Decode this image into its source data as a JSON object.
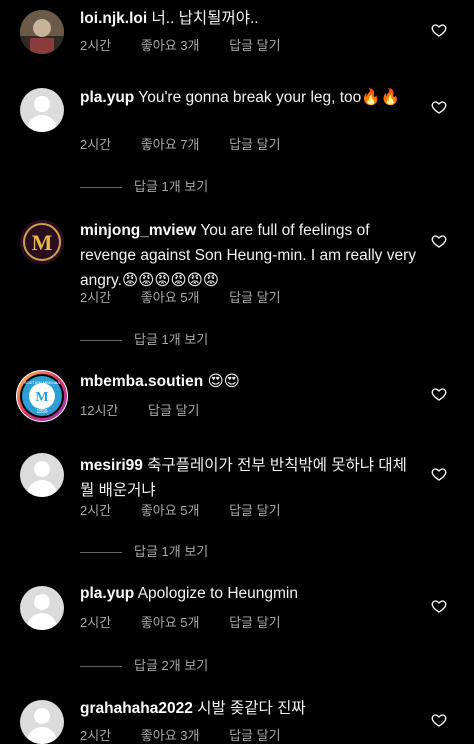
{
  "comments": [
    {
      "username": "loi.njk.loi",
      "text": "너.. 납치될꺼야..",
      "time": "2시간",
      "likes": "좋아요 3개",
      "reply": "답글 달기"
    },
    {
      "username": "pla.yup",
      "text": "You're gonna break your leg, too🔥🔥",
      "time": "2시간",
      "likes": "좋아요 7개",
      "reply": "답글 달기",
      "view_replies": "답글 1개 보기"
    },
    {
      "username": "minjong_mview",
      "text": "You are full of feelings of revenge against Son Heung-min.  I am really very angry.😡😡😡😡😡😡",
      "time": "2시간",
      "likes": "좋아요 5개",
      "reply": "답글 달기",
      "view_replies": "답글 1개 보기"
    },
    {
      "username": "mbemba.soutien",
      "text": "😍😍",
      "time": "12시간",
      "reply": "답글 달기"
    },
    {
      "username": "mesiri99",
      "text": "축구플레이가 전부 반칙밖에 못하냐 대체 뭘 배운거냐",
      "time": "2시간",
      "likes": "좋아요 5개",
      "reply": "답글 달기",
      "view_replies": "답글 1개 보기"
    },
    {
      "username": "pla.yup",
      "text": "Apologize to Heungmin",
      "time": "2시간",
      "likes": "좋아요 5개",
      "reply": "답글 달기",
      "view_replies": "답글 2개 보기"
    },
    {
      "username": "grahahaha2022",
      "text": "시발 좆같다 진짜",
      "time": "2시간",
      "likes": "좋아요 3개",
      "reply": "답글 달기"
    }
  ],
  "icons": {
    "like": "heart-outline-icon",
    "avatar": "default-avatar-icon"
  },
  "avatar_letters": {
    "minjong": "M",
    "mbemba_ring": "SOUTIEN MBEMBA",
    "mbemba_year": "1899"
  }
}
